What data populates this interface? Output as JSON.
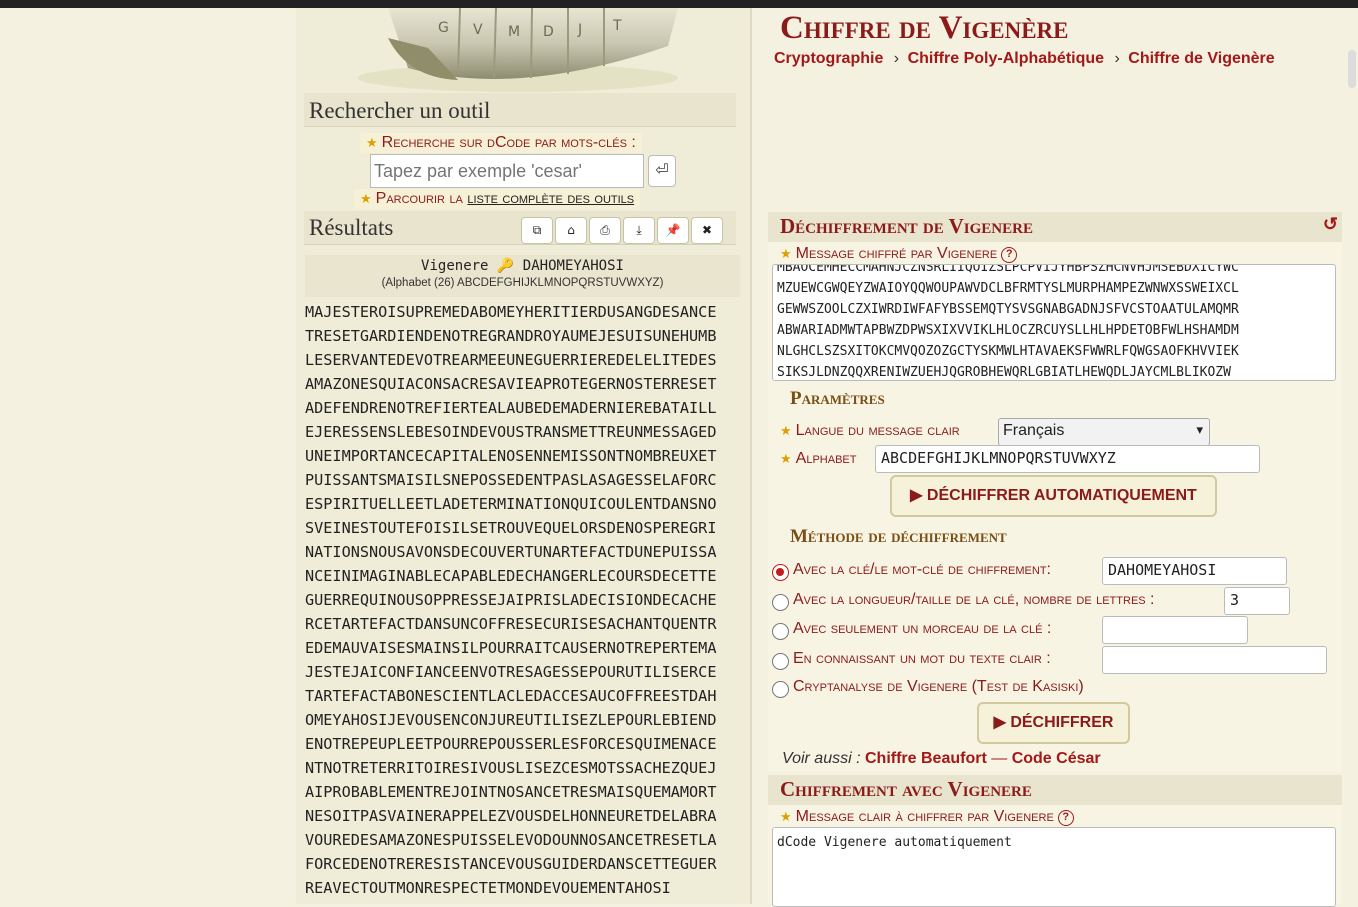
{
  "search": {
    "title": "Rechercher un outil",
    "keyword_label": "Recherche sur dCode par mots-clés :",
    "placeholder": "Tapez par exemple 'cesar'",
    "enter_glyph": "⏎",
    "browse_prefix": "Parcourir la",
    "browse_link": "liste complète des outils"
  },
  "results": {
    "title": "Résultats",
    "toolbar_icons": [
      "copy-icon",
      "screenshot-icon",
      "print-icon",
      "download-icon",
      "pin-icon",
      "close-icon"
    ],
    "toolbar_glyphs": [
      "⧉",
      "⌂",
      "⎙",
      "⤓",
      "📌",
      "✖"
    ],
    "cipher_label": "Vigenere",
    "key_glyph": "🔑",
    "key": "DAHOMEYAHOSI",
    "alphabet_line": "(Alphabet (26) ABCDEFGHIJKLMNOPQRSTUVWXYZ)",
    "text_lines": [
      "MAJESTEROISUPREMEDABOMEYHERITIERDUSANGDESANCE",
      "TRESETGARDIENDENOTREGRANDROYAUMEJESUISUNEHUMB",
      "LESERVANTEDEVOTREARMEEUNEGUERRIEREDELELITEDES",
      "AMAZONESQUIACONSACRESAVIEAPROTEGERNOSTERRESET",
      "ADEFENDRENOTREFIERTEALAUBEDEMADERNIEREBATAILL",
      "EJERESSENSLEBESOINDEVOUSTRANSMETTREUNMESSAGED",
      "UNEIMPORTANCECAPITALENOSENNEMISSONTNOMBREUXET",
      "PUISSANTSMAISILSNEPOSSEDENTPASLASAGESSELAFORC",
      "ESPIRITUELLEETLADETERMINATIONQUICOULENTDANSNO",
      "SVEINESTOUTEFOISILSETROUVEQUELORSDENOSPEREGRI",
      "NATIONSNOUSAVONSDECOUVERTUNARTEFACTDUNEPUISSA",
      "NCEINIMAGINABLECAPABLEDECHANGERLECOURSDECETTE",
      "GUERREQUINOUSOPPRESSEJAIPRISLADECISIONDECACHE",
      "RCETARTEFACTDANSUNCOFFRESECURISESACHANTQUENTR",
      "EDEMAUVAISESMAINSILPOURRAITCAUSERNOTREPERTEMA",
      "JESTEJAICONFIANCEENVOTRESAGESSEPOURUTILISERCE",
      "TARTEFACTABONESCIENTLACLEDACCESAUCOFFREESTDAH",
      "OMEYAHOSIJEVOUSENCONJUREUTILISEZLEPOURLEBIEND",
      "ENOTREPEUPLEETPOURREPOUSSERLESFORCESQUIMENACE",
      "NTNOTRETERRITOIRESIVOUSLISEZCESMOTSSACHEZQUEJ",
      "AIPROBABLEMENTREJOINTNOSANCETRESMAISQUEMAMORT",
      "NESOITPASVAINERAPPELEZVOUSDELHONNEURETDELABRA",
      "VOUREDESAMAZONESPUISSELEVODOUNNOSANCETRESETLA",
      "FORCEDENOTRERESISTANCEVOUSGUIDERDANSCETTEGUER",
      "REAVECTOUTMONRESPECTETMONDEVOUEMENTAHOSI"
    ]
  },
  "page": {
    "title": "Chiffre de Vigenère",
    "breadcrumb": [
      "Cryptographie",
      "Chiffre Poly-Alphabétique",
      "Chiffre de Vigenère"
    ],
    "breadcrumb_sep": "›"
  },
  "decrypt": {
    "section_title": "Déchiffrement de Vigenere",
    "reset_glyph": "↺",
    "message_label": "Message chiffré par Vigenere",
    "help_glyph": "?",
    "message_lines": [
      "MBAOCEMHECCMAHNJCZNSRLIIQOIZSLPCPVIJYHBPSZHCNVHJMSEBDXICYWC",
      "MZUEWCGWQEYZWAIOYQQWOUPAWVDCLBFRMTYSLMURPHAMPEZWNWXSSWEIXCL",
      "GEWWSZOOLCZXIWRDIWFAFYBSSEMQTYSVSGNABGADNJSFVCSTOAATULAMQMR",
      "ABWARIADMWTAPBWZDPWSXIXVVIKLHLOCZRCUYSLLHLHPDETOBFWLHSHAMDM",
      "NLGHCLSZSXITOKCMVQOZOZGCTYSKMWLHTAVAEKSFWWRLFQWGSAOFKHVVIEK",
      "SIKSJLDNZQQXRENIWZUEHJQGROBHEWQRLGBIATLHEWQDLJAYCMLBLIKOZW"
    ],
    "params_title": "Paramètres",
    "language_label": "Langue du message clair",
    "language_value": "Français",
    "alphabet_label": "Alphabet",
    "alphabet_value": "ABCDEFGHIJKLMNOPQRSTUVWXYZ",
    "auto_button": "▶ DÉCHIFFRER AUTOMATIQUEMENT",
    "method_title": "Méthode de déchiffrement",
    "methods": [
      {
        "label": "Avec la clé/le mot-clé de chiffrement:",
        "value": "DAHOMEYAHOSI",
        "selected": true
      },
      {
        "label": "Avec la longueur/taille de la clé, nombre de lettres :",
        "value": "3",
        "selected": false
      },
      {
        "label": "Avec seulement un morceau de la clé :",
        "value": "",
        "selected": false
      },
      {
        "label": "En connaissant un mot du texte clair :",
        "value": "",
        "selected": false
      },
      {
        "label": "Cryptanalyse de Vigenere (Test de Kasiski)",
        "selected": false
      }
    ],
    "decrypt_button": "▶ DÉCHIFFRER",
    "see_also_label": "Voir aussi :",
    "see_also_links": [
      "Chiffre Beaufort",
      "Code César"
    ],
    "see_also_sep": "—"
  },
  "encrypt": {
    "section_title": "Chiffrement avec Vigenere",
    "message_label": "Message clair à chiffrer par Vigenere",
    "message_value": "dCode Vigenere automatiquement"
  }
}
